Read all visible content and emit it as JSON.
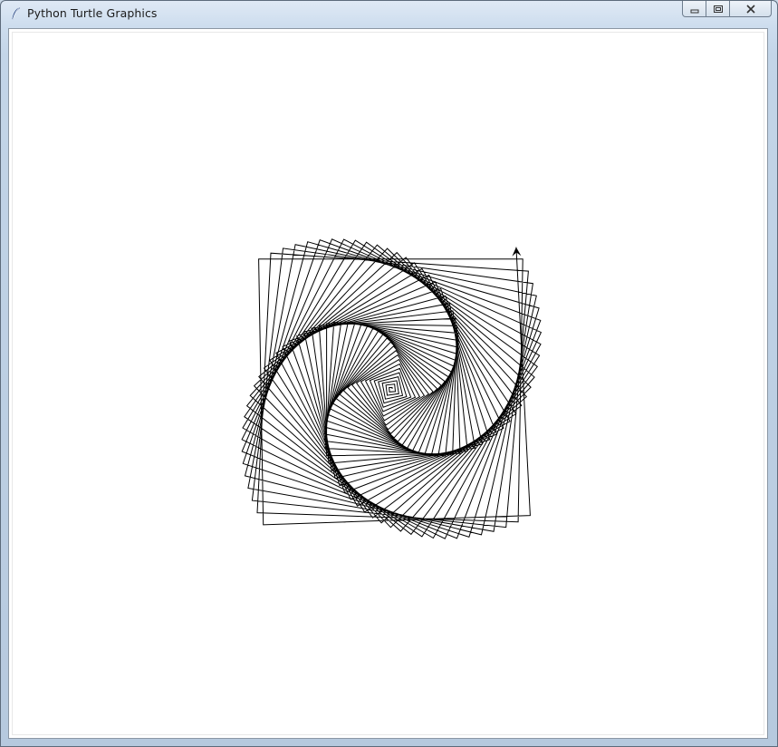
{
  "window": {
    "title": "Python Turtle Graphics",
    "app_icon": "feather-icon",
    "caption_buttons": [
      "minimize-icon",
      "maximize-icon",
      "close-icon"
    ]
  },
  "canvas": {
    "background": "#ffffff",
    "pen_color": "#000000",
    "turtle_shape": "arrow-icon"
  }
}
